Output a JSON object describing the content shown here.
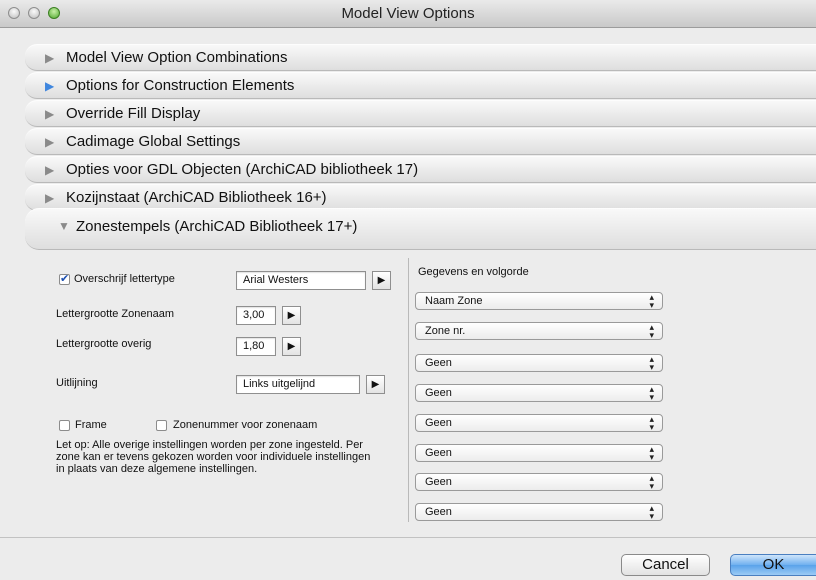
{
  "window": {
    "title": "Model View Options"
  },
  "sections": [
    {
      "label": "Model View Option Combinations",
      "state": "collapsed"
    },
    {
      "label": "Options for Construction Elements",
      "state": "active"
    },
    {
      "label": "Override Fill Display",
      "state": "collapsed"
    },
    {
      "label": "Cadimage Global Settings",
      "state": "collapsed"
    },
    {
      "label": "Opties voor GDL Objecten (ArchiCAD bibliotheek 17)",
      "state": "collapsed"
    },
    {
      "label": "Kozijnstaat (ArchiCAD Bibliotheek 16+)",
      "state": "collapsed"
    },
    {
      "label": "Zonestempels (ArchiCAD Bibliotheek 17+)",
      "state": "expanded"
    }
  ],
  "panel": {
    "font_override": {
      "label": "Overschrijf lettertype",
      "checked": true,
      "value": "Arial Westers"
    },
    "zone_name_size": {
      "label": "Lettergrootte Zonenaam",
      "value": "3,00"
    },
    "other_size": {
      "label": "Lettergrootte overig",
      "value": "1,80"
    },
    "alignment": {
      "label": "Uitlijning",
      "value": "Links uitgelijnd"
    },
    "frame": {
      "label": "Frame",
      "checked": false
    },
    "zone_number_first": {
      "label": "Zonenummer voor zonenaam",
      "checked": false
    },
    "note": "Let op: Alle overige instellingen worden per zone ingesteld. Per zone kan er tevens gekozen worden voor individuele instellingen in plaats van deze algemene instellingen.",
    "order_title": "Gegevens en volgorde",
    "order_items": [
      "Naam Zone",
      "Zone nr.",
      "Geen",
      "Geen",
      "Geen",
      "Geen",
      "Geen",
      "Geen"
    ]
  },
  "buttons": {
    "cancel": "Cancel",
    "ok": "OK"
  },
  "colors": {
    "accent": "#3f86de",
    "default_button": "#5aa3ea"
  }
}
